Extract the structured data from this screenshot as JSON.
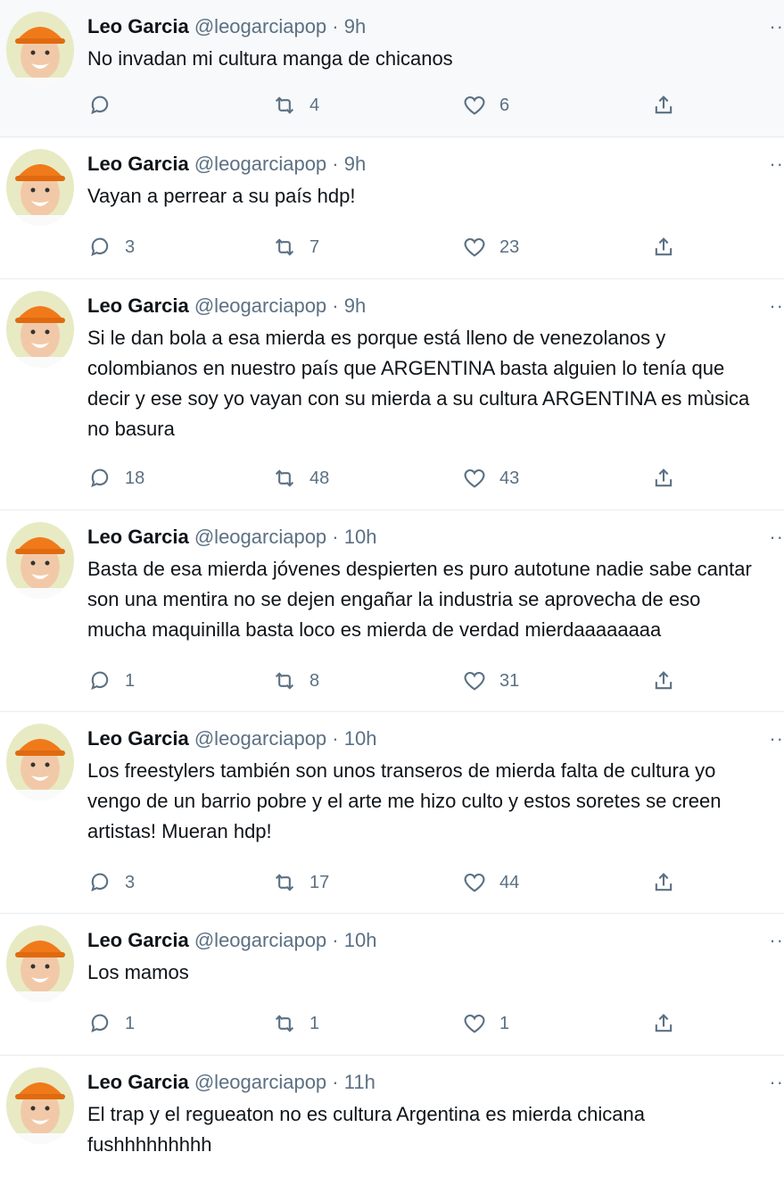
{
  "colors": {
    "text": "#0f1419",
    "secondary": "#5b7083",
    "divider": "#e6ecf0",
    "highlight_bg": "#f7f9fa"
  },
  "icons": {
    "reply": "reply-icon",
    "retweet": "retweet-icon",
    "like": "like-icon",
    "share": "share-icon",
    "more": "more-icon"
  },
  "tweets": [
    {
      "name": "Leo Garcia",
      "handle": "@leogarciapop",
      "separator": "·",
      "time": "9h",
      "text": "No invadan mi cultura manga de chicanos",
      "replies": "",
      "retweets": "4",
      "likes": "6"
    },
    {
      "name": "Leo Garcia",
      "handle": "@leogarciapop",
      "separator": "·",
      "time": "9h",
      "text": "Vayan a perrear a su país hdp!",
      "replies": "3",
      "retweets": "7",
      "likes": "23"
    },
    {
      "name": "Leo Garcia",
      "handle": "@leogarciapop",
      "separator": "·",
      "time": "9h",
      "text": "Si le dan bola a esa mierda es porque está lleno de venezolanos y\ncolombianos en nuestro país que ARGENTINA basta alguien lo tenía que\ndecir y ese soy yo vayan con su mierda a su cultura ARGENTINA es mùsica\nno basura",
      "replies": "18",
      "retweets": "48",
      "likes": "43"
    },
    {
      "name": "Leo Garcia",
      "handle": "@leogarciapop",
      "separator": "·",
      "time": "10h",
      "text": "Basta de esa mierda jóvenes despierten es puro autotune nadie sabe cantar\nson una mentira no se dejen engañar la industria se aprovecha de eso\nmucha maquinilla basta loco es mierda de verdad mierdaaaaaaaa",
      "replies": "1",
      "retweets": "8",
      "likes": "31"
    },
    {
      "name": "Leo Garcia",
      "handle": "@leogarciapop",
      "separator": "·",
      "time": "10h",
      "text": "Los freestylers también son unos transeros de mierda falta de cultura yo\nvengo de un barrio pobre y el arte me hizo culto y estos soretes se creen\nartistas! Mueran hdp!",
      "replies": "3",
      "retweets": "17",
      "likes": "44"
    },
    {
      "name": "Leo Garcia",
      "handle": "@leogarciapop",
      "separator": "·",
      "time": "10h",
      "text": "Los mamos",
      "replies": "1",
      "retweets": "1",
      "likes": "1"
    },
    {
      "name": "Leo Garcia",
      "handle": "@leogarciapop",
      "separator": "·",
      "time": "11h",
      "text": "El trap y el regueaton no es cultura Argentina es mierda chicana\nfushhhhhhhhh",
      "replies": "",
      "retweets": "",
      "likes": ""
    }
  ]
}
